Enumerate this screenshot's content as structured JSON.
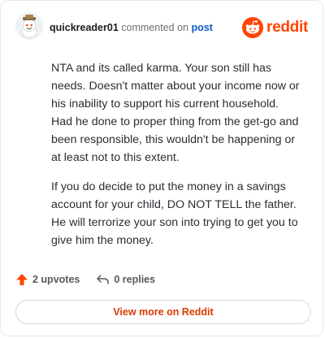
{
  "header": {
    "username": "quickreader01",
    "action_text": "commented on",
    "post_link": "post",
    "brand_name": "reddit",
    "avatar_icon": "snoo-avatar-icon",
    "brand_icon": "reddit-logo-icon"
  },
  "comment": {
    "paragraphs": [
      "NTA and its called karma. Your son still has needs. Doesn't matter about your income now or his inability to support his current household. Had he done to proper thing from the get-go and been responsible, this wouldn't be happening or at least not to this extent.",
      "If you do decide to put the money in a savings account for your child, DO NOT TELL the father. He will terrorize your son into trying to get you to give him the money."
    ]
  },
  "stats": {
    "upvotes": "2 upvotes",
    "replies": "0 replies",
    "upvote_icon": "upvote-arrow-icon",
    "reply_icon": "reply-arrow-icon"
  },
  "footer": {
    "view_more": "View more on Reddit"
  },
  "colors": {
    "brand_orange": "#ff4500",
    "link_blue": "#0b5ec5",
    "button_text": "#d93a00"
  }
}
